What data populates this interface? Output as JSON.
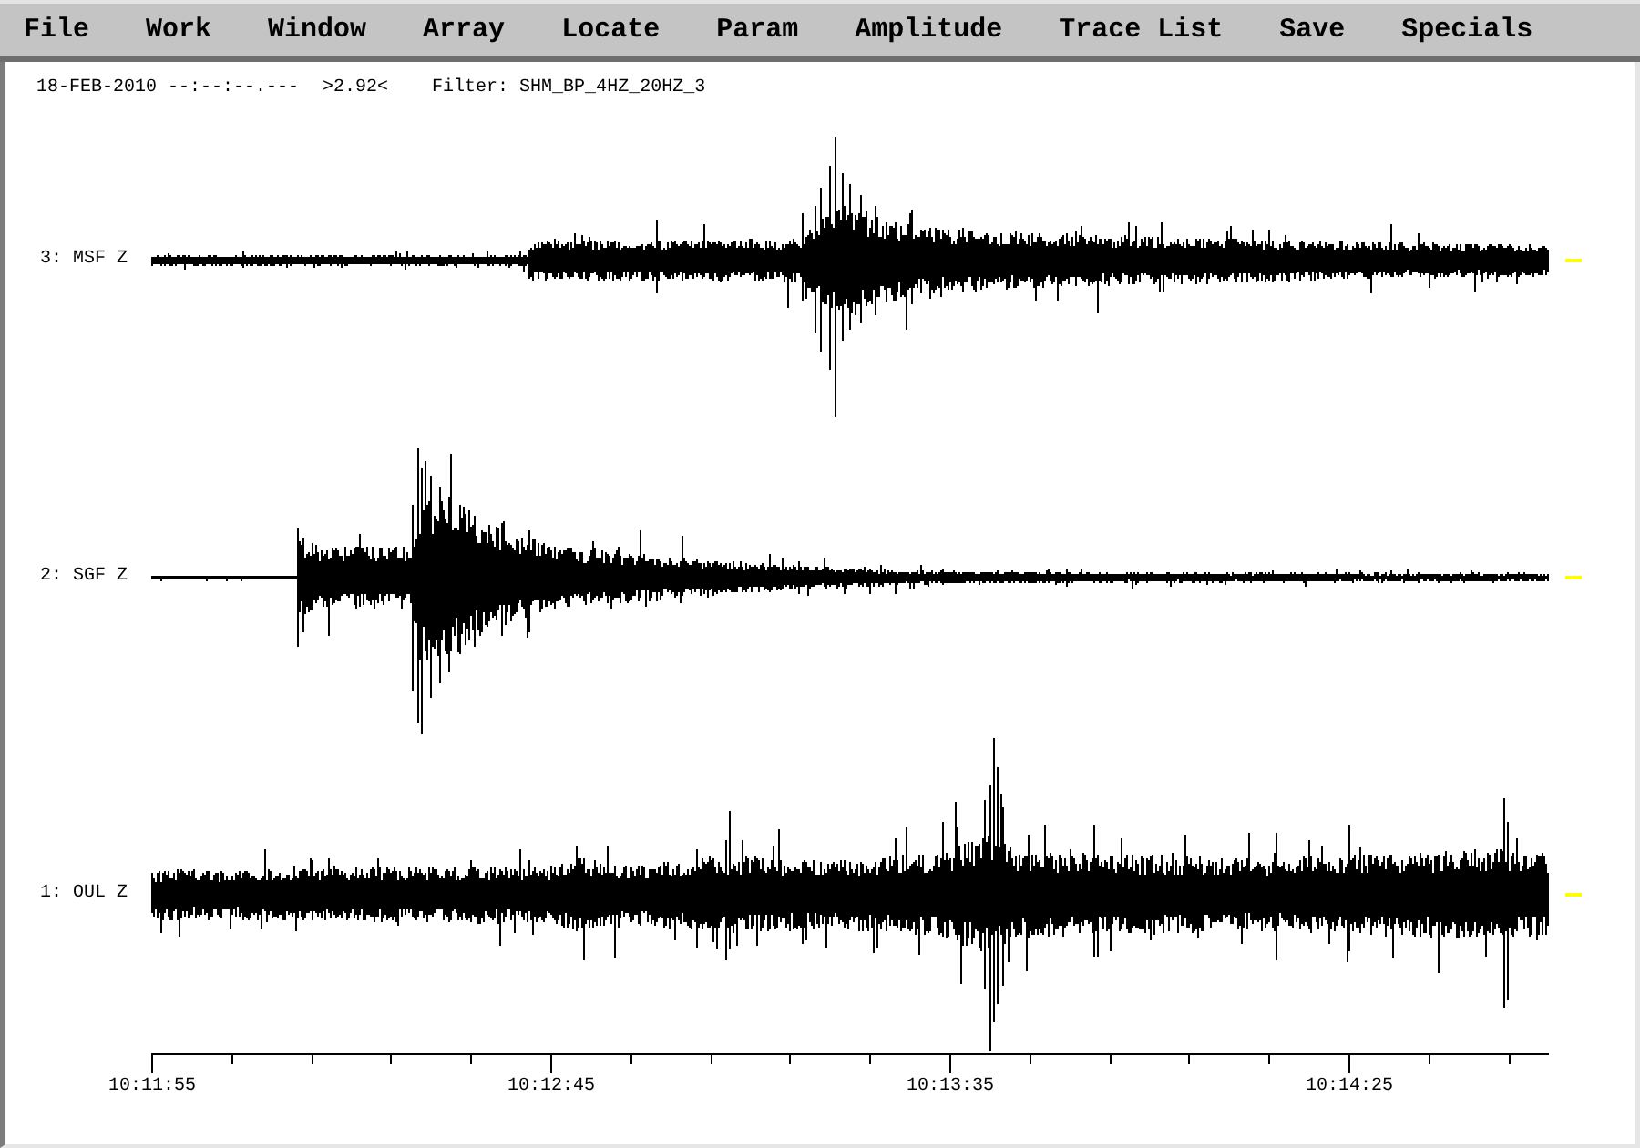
{
  "menu_bar": [
    "File",
    "Work",
    "Window",
    "Array",
    "Locate",
    "Param",
    "Amplitude",
    "Trace List",
    "Save",
    "Specials"
  ],
  "status_line": {
    "date_time": "18-FEB-2010 --:--:--.---",
    "amplitude": ">2.92<",
    "filter": "Filter: SHM_BP_4HZ_20HZ_3"
  },
  "traces": [
    {
      "label": "3: MSF Z"
    },
    {
      "label": "2: SGF Z"
    },
    {
      "label": "1: OUL Z"
    }
  ],
  "time_axis": {
    "tick_labels": [
      "10:11:55",
      "10:12:45",
      "10:13:35",
      "10:14:25"
    ]
  }
}
